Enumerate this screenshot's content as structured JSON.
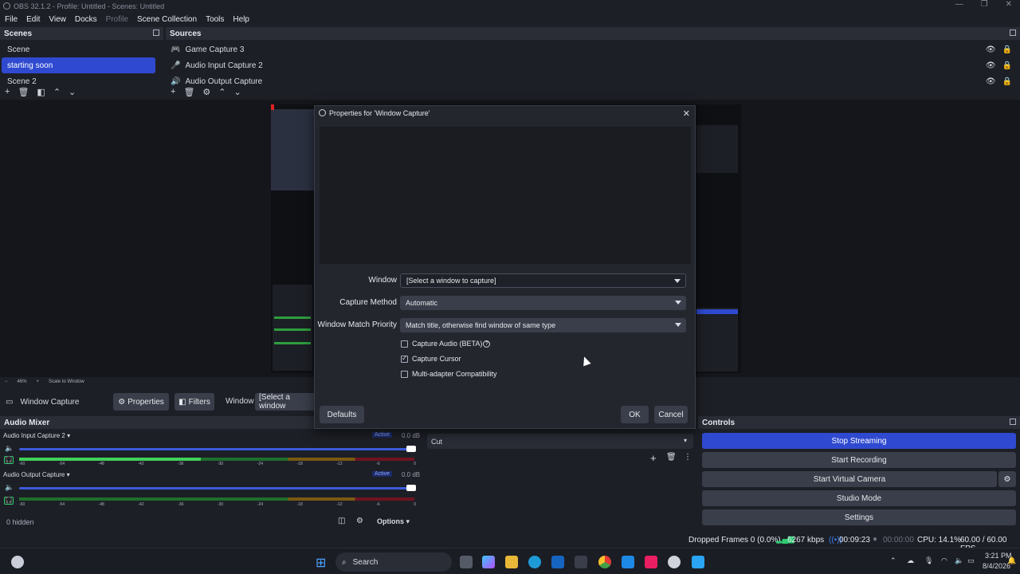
{
  "window": {
    "title": "OBS 32.1.2 - Profile: Untitled - Scenes: Untitled"
  },
  "menu": [
    "File",
    "Edit",
    "View",
    "Docks",
    "Profile",
    "Scene Collection",
    "Tools",
    "Help"
  ],
  "scenes": {
    "title": "Scenes",
    "items": [
      "Scene",
      "starting soon",
      "Scene 2"
    ],
    "selected_index": 1
  },
  "sources": {
    "title": "Sources",
    "items": [
      {
        "name": "Game Capture 3",
        "icon": "gamepad-icon"
      },
      {
        "name": "Audio Input Capture 2",
        "icon": "microphone-icon"
      },
      {
        "name": "Audio Output Capture",
        "icon": "speaker-icon"
      }
    ]
  },
  "preview": {
    "zoom": "46%",
    "scale": "Scale to Window"
  },
  "source_bar": {
    "name": "Window Capture",
    "properties": "Properties",
    "filters": "Filters",
    "window_label": "Window",
    "window_value": "[Select a window"
  },
  "dialog": {
    "title": "Properties for 'Window Capture'",
    "window_label": "Window",
    "window_value": "[Select a window to capture]",
    "capture_method_label": "Capture Method",
    "capture_method_value": "Automatic",
    "match_priority_label": "Window Match Priority",
    "match_priority_value": "Match title, otherwise find window of same type",
    "capture_audio": {
      "label": "Capture Audio (BETA)",
      "checked": false
    },
    "capture_cursor": {
      "label": "Capture Cursor",
      "checked": true
    },
    "multi_adapter": {
      "label": "Multi-adapter Compatibility",
      "checked": false
    },
    "defaults": "Defaults",
    "ok": "OK",
    "cancel": "Cancel"
  },
  "mixer": {
    "title": "Audio Mixer",
    "channels": [
      {
        "name": "Audio Input Capture 2",
        "status": "Active",
        "db": "0.0 dB",
        "level": 0.46
      },
      {
        "name": "Audio Output Capture",
        "status": "Active",
        "db": "0.0 dB",
        "level": 0.0
      }
    ],
    "ticks": [
      "-60",
      "-54",
      "-48",
      "-42",
      "-36",
      "-30",
      "-24",
      "-18",
      "-12",
      "-6",
      "0"
    ],
    "hidden": "0 hidden",
    "options": "Options"
  },
  "transitions": {
    "value": "Cut"
  },
  "controls": {
    "title": "Controls",
    "stop_streaming": "Stop Streaming",
    "start_recording": "Start Recording",
    "start_virtual_camera": "Start Virtual Camera",
    "studio_mode": "Studio Mode",
    "settings": "Settings"
  },
  "status": {
    "dropped_frames": "Dropped Frames 0 (0.0%)",
    "bitrate": "6267 kbps",
    "stream_time": "00:09:23",
    "rec_time": "00:00:00",
    "cpu": "CPU: 14.1%",
    "fps": "60.00 / 60.00 FPS"
  },
  "taskbar": {
    "search": "Search",
    "time": "3:21 PM",
    "date": "8/4/2026"
  },
  "colors": {
    "accent": "#2f4ad0",
    "bg": "#1d1f26",
    "panel_header": "#2a2d36",
    "button": "#3a3e4a"
  }
}
